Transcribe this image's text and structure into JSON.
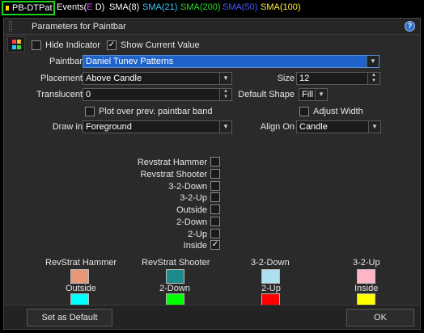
{
  "topbar": {
    "active_tab": "PB-DTPat",
    "events_label": "Events(",
    "events_e": "E",
    "events_d": "D",
    "events_close": ")",
    "indicators": [
      {
        "label": "SMA(8)",
        "color": "#ffffff"
      },
      {
        "label": "SMA(21)",
        "color": "#3bc6ff"
      },
      {
        "label": "SMA(200)",
        "color": "#22dd22"
      },
      {
        "label": "SMA(50)",
        "color": "#3b4dff"
      },
      {
        "label": "SMA(100)",
        "color": "#ffee33"
      }
    ]
  },
  "dialog": {
    "title": "Parameters for Paintbar",
    "help_icon": "?",
    "hide_indicator": {
      "label": "Hide Indicator",
      "checked": false
    },
    "show_current_value": {
      "label": "Show Current Value",
      "checked": true
    },
    "paintbar": {
      "label": "Paintbar",
      "value": "Daniel Tunev Patterns"
    },
    "placement": {
      "label": "Placement",
      "value": "Above Candle"
    },
    "size": {
      "label": "Size",
      "value": "12"
    },
    "translucent": {
      "label": "Translucent",
      "value": "0"
    },
    "default_shape": {
      "label": "Default Shape",
      "value": "Fill"
    },
    "plot_over": {
      "label": "Plot over prev. paintbar band",
      "checked": false
    },
    "adjust_width": {
      "label": "Adjust Width",
      "checked": false
    },
    "draw_in": {
      "label": "Draw in",
      "value": "Foreground"
    },
    "align_on": {
      "label": "Align On",
      "value": "Candle"
    },
    "patterns": [
      {
        "label": "Revstrat Hammer",
        "checked": false
      },
      {
        "label": "Revstrat Shooter",
        "checked": false
      },
      {
        "label": "3-2-Down",
        "checked": false
      },
      {
        "label": "3-2-Up",
        "checked": false
      },
      {
        "label": "Outside",
        "checked": false
      },
      {
        "label": "2-Down",
        "checked": false
      },
      {
        "label": "2-Up",
        "checked": false
      },
      {
        "label": "Inside",
        "checked": true
      }
    ],
    "colors": [
      {
        "label": "RevStrat Hammer",
        "color": "#e8967a"
      },
      {
        "label": "RevStrat Shooter",
        "color": "#1a8c8c"
      },
      {
        "label": "3-2-Down",
        "color": "#ace0ee"
      },
      {
        "label": "3-2-Up",
        "color": "#ffb6c4"
      },
      {
        "label": "Outside",
        "color": "#00ffff"
      },
      {
        "label": "2-Down",
        "color": "#00ff00"
      },
      {
        "label": "2-Up",
        "color": "#ff0000"
      },
      {
        "label": "Inside",
        "color": "#ffff00"
      }
    ],
    "set_default_label": "Set as Default",
    "ok_label": "OK",
    "check_mark": "✓",
    "dropdown_arrow": "▼",
    "spin_up": "▲",
    "spin_down": "▼"
  }
}
